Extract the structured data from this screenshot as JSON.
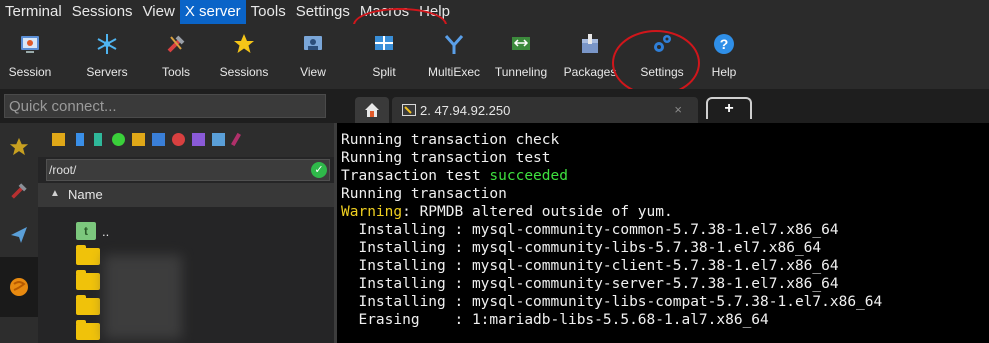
{
  "menu": {
    "items": [
      "Terminal",
      "Sessions",
      "View",
      "X server",
      "Tools",
      "Settings",
      "Macros",
      "Help"
    ],
    "active_index": 3
  },
  "toolbar": {
    "buttons": [
      {
        "label": "Session",
        "icon": "session-icon"
      },
      {
        "label": "Servers",
        "icon": "servers-icon"
      },
      {
        "label": "Tools",
        "icon": "tools-icon"
      },
      {
        "label": "Sessions",
        "icon": "star-icon"
      },
      {
        "label": "View",
        "icon": "view-icon"
      },
      {
        "label": "Split",
        "icon": "split-icon"
      },
      {
        "label": "MultiExec",
        "icon": "multiexec-icon"
      },
      {
        "label": "Tunneling",
        "icon": "tunneling-icon"
      },
      {
        "label": "Packages",
        "icon": "packages-icon"
      },
      {
        "label": "Settings",
        "icon": "settings-gears-icon"
      },
      {
        "label": "Help",
        "icon": "help-icon"
      }
    ]
  },
  "quick_connect": {
    "placeholder": "Quick connect..."
  },
  "tabs": {
    "session_tab_title": "2. 47.94.92.250",
    "close_glyph": "×",
    "add_glyph": "+"
  },
  "sidebar": {
    "tabs": [
      "favorites-star-icon",
      "tools-icon",
      "sftp-icon",
      "macros-icon"
    ]
  },
  "sftp": {
    "path": "/root/",
    "column_name": "Name",
    "sort_glyph": "▲",
    "rows": [
      {
        "type": "parent",
        "name": ".."
      },
      {
        "type": "folder",
        "name": ""
      },
      {
        "type": "folder",
        "name": ""
      },
      {
        "type": "folder",
        "name": ""
      },
      {
        "type": "folder",
        "name": ""
      }
    ]
  },
  "terminal": {
    "lines": [
      {
        "text": "Running transaction check"
      },
      {
        "text": "Running transaction test"
      },
      {
        "prefix": "Transaction test ",
        "green": "succeeded"
      },
      {
        "text": "Running transaction"
      },
      {
        "yellow": "Warning",
        "suffix": ": RPMDB altered outside of yum."
      },
      {
        "text": "  Installing : mysql-community-common-5.7.38-1.el7.x86_64"
      },
      {
        "text": "  Installing : mysql-community-libs-5.7.38-1.el7.x86_64"
      },
      {
        "text": "  Installing : mysql-community-client-5.7.38-1.el7.x86_64"
      },
      {
        "text": "  Installing : mysql-community-server-5.7.38-1.el7.x86_64"
      },
      {
        "text": "  Installing : mysql-community-libs-compat-5.7.38-1.el7.x86_64"
      },
      {
        "text": "  Erasing    : 1:mariadb-libs-5.5.68-1.al7.x86_64"
      }
    ]
  },
  "colors": {
    "menu_active": "#0a64c8",
    "annotation_red": "#d0161b",
    "term_green": "#3ee03e",
    "term_yellow": "#f0d020"
  }
}
